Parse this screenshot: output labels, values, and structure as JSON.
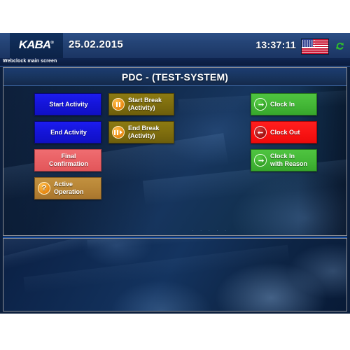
{
  "header": {
    "logo": "KABA",
    "logo_registered": "®",
    "date": "25.02.2015",
    "time": "13:37:11",
    "flag_icon": "us-flag-icon",
    "refresh_icon": "refresh-icon"
  },
  "statusbar": {
    "text": "Webclock main screen"
  },
  "main": {
    "title": "PDC - (TEST-SYSTEM)",
    "dots": "· · · · ·"
  },
  "buttons": {
    "column_left": [
      {
        "label": "Start Activity",
        "color": "#1414d8",
        "icon": null
      },
      {
        "label": "End Activity",
        "color": "#1414d8",
        "icon": null
      },
      {
        "label": "Final\nConfirmation",
        "line1": "Final",
        "line2": "Confirmation",
        "color": "#e96165",
        "icon": null
      },
      {
        "label": "Active\nOperation",
        "line1": "Active",
        "line2": "Operation",
        "color": "#b78536",
        "icon": "question-mark-icon"
      }
    ],
    "column_middle": [
      {
        "label": "Start Break\n(Activity)",
        "line1": "Start Break",
        "line2": "(Activity)",
        "color": "#7f6e0e",
        "icon": "pause-icon"
      },
      {
        "label": "End Break\n(Activity)",
        "line1": "End Break",
        "line2": "(Activity)",
        "color": "#7f6e0e",
        "icon": "resume-icon"
      }
    ],
    "column_right": [
      {
        "label": "Clock In",
        "color": "#44b837",
        "icon": "arrow-in-circle-icon"
      },
      {
        "label": "Clock Out",
        "color": "#f91414",
        "icon": "arrow-out-circle-icon"
      },
      {
        "label": "Clock In\nwith Reason",
        "line1": "Clock In",
        "line2": "with Reason",
        "color": "#44b837",
        "icon": "arrow-in-circle-icon"
      }
    ]
  },
  "colors": {
    "header_blue": "#244375",
    "panel_blue": "#11294a",
    "accent_border": "#3e6aa8",
    "blue_button": "#1414d8",
    "olive_button": "#7f6e0e",
    "salmon_button": "#e96165",
    "tan_button": "#b78536",
    "green_button": "#44b837",
    "red_button": "#f91414"
  }
}
